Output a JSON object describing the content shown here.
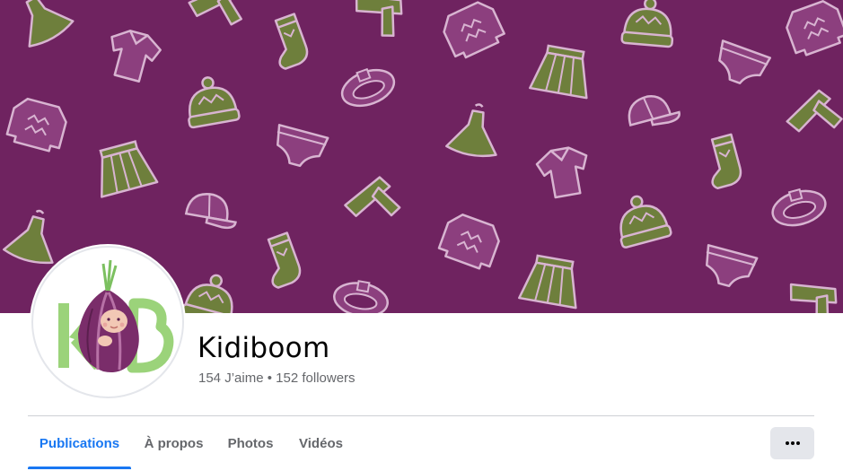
{
  "page": {
    "name": "Kidiboom",
    "likes": "154 J’aime",
    "separator": "•",
    "followers": "152 followers"
  },
  "tabs": [
    {
      "label": "Publications",
      "active": true
    },
    {
      "label": "À propos",
      "active": false
    },
    {
      "label": "Photos",
      "active": false
    },
    {
      "label": "Vidéos",
      "active": false
    }
  ],
  "more_button": {
    "icon": "more-horizontal-icon"
  },
  "colors": {
    "cover_background": "#6f2360",
    "pattern_green": "#6e7f3c",
    "pattern_pink": "#8c3f7e",
    "pattern_outline": "#d8b4d1",
    "accent_blue": "#1877f2",
    "logo_green": "#9bd37a"
  },
  "cover": {
    "pattern": "kids-clothing-pattern"
  },
  "avatar": {
    "logo_text": "KB"
  }
}
